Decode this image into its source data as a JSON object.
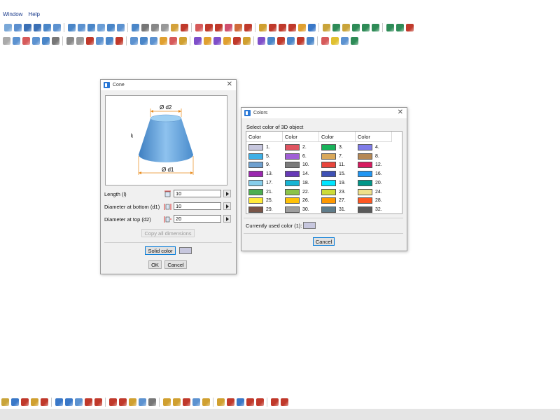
{
  "menu": [
    "Window",
    "Help"
  ],
  "cone_dialog": {
    "title": "Cone",
    "diagram": {
      "d2": "Ø d2",
      "d1": "Ø d1",
      "l": "l"
    },
    "fields": [
      {
        "label": "Length (l)",
        "value": "10"
      },
      {
        "label": "Diameter at bottom (d1)",
        "value": "10"
      },
      {
        "label": "Diameter at top (d2)",
        "value": "20"
      }
    ],
    "copy_button": "Copy all dimensions",
    "solid_color_button": "Solid color",
    "solid_color_value": "#c7c7de",
    "ok_button": "OK",
    "cancel_button": "Cancel"
  },
  "colors_dialog": {
    "title": "Colors",
    "prompt": "Select color of 3D object",
    "column_header": "Color",
    "swatches": [
      {
        "n": "1.",
        "c": "#c7c7de"
      },
      {
        "n": "2.",
        "c": "#e05561"
      },
      {
        "n": "3.",
        "c": "#19b35b"
      },
      {
        "n": "4.",
        "c": "#7f7ce8"
      },
      {
        "n": "5.",
        "c": "#3fb0e6"
      },
      {
        "n": "6.",
        "c": "#a05fd6"
      },
      {
        "n": "7.",
        "c": "#d9a85a"
      },
      {
        "n": "8.",
        "c": "#b58855"
      },
      {
        "n": "9.",
        "c": "#6ea0cf"
      },
      {
        "n": "10.",
        "c": "#7b7b7b"
      },
      {
        "n": "11.",
        "c": "#e8453c"
      },
      {
        "n": "12.",
        "c": "#d81b60"
      },
      {
        "n": "13.",
        "c": "#9c27b0"
      },
      {
        "n": "14.",
        "c": "#673ab7"
      },
      {
        "n": "15.",
        "c": "#3f51b5"
      },
      {
        "n": "16.",
        "c": "#2196f3"
      },
      {
        "n": "17.",
        "c": "#87ceeb"
      },
      {
        "n": "18.",
        "c": "#16b4d3"
      },
      {
        "n": "19.",
        "c": "#00e5ff"
      },
      {
        "n": "20.",
        "c": "#009688"
      },
      {
        "n": "21.",
        "c": "#4caf50"
      },
      {
        "n": "22.",
        "c": "#8bc34a"
      },
      {
        "n": "23.",
        "c": "#cddc39"
      },
      {
        "n": "24.",
        "c": "#efe08a"
      },
      {
        "n": "25.",
        "c": "#ffeb3b"
      },
      {
        "n": "26.",
        "c": "#ffc107"
      },
      {
        "n": "27.",
        "c": "#ff9800"
      },
      {
        "n": "28.",
        "c": "#ff5722"
      },
      {
        "n": "29.",
        "c": "#795548"
      },
      {
        "n": "30.",
        "c": "#9e9e9e"
      },
      {
        "n": "31.",
        "c": "#607d8b"
      },
      {
        "n": "32.",
        "c": "#5a5a5a"
      }
    ],
    "current_label": "Currently used color (1):",
    "current_color": "#c7c7de",
    "cancel_button": "Cancel"
  },
  "toolbar_icon_colors": {
    "row1": [
      "#7aa8d8",
      "#5b8fcf",
      "#3a6fb5",
      "#3a6fb5",
      "#4a86c8",
      "#5c92d0",
      "#4a86c8",
      "#5c92d0",
      "#4a86c8",
      "#6b9ed6",
      "#4a86c8",
      "#5c92d0",
      "#4a86c8",
      "#777777",
      "#888888",
      "#999999",
      "#d4a23a",
      "#c0392b",
      "#d65a5a",
      "#c0392b",
      "#c0392b",
      "#d0506f",
      "#d06a3a",
      "#c0392b",
      "#d0a030",
      "#c0392b",
      "#c0392b",
      "#c0392b",
      "#e0a030",
      "#3a78c8",
      "#c9a43a",
      "#2e8b57",
      "#c9a43a",
      "#2e8b57",
      "#2e8b57",
      "#2e8b57",
      "#2e8b57",
      "#2e8b57",
      "#c0392b"
    ],
    "row2": [
      "#aaaaaa",
      "#5c92d0",
      "#d65a5a",
      "#5c92d0",
      "#4a86c8",
      "#777777",
      "#888888",
      "#999999",
      "#c0392b",
      "#5c92d0",
      "#4a86c8",
      "#c0392b",
      "#5c92d0",
      "#4a86c8",
      "#5c92d0",
      "#e0a030",
      "#d65a5a",
      "#d0a030",
      "#7f4fc9",
      "#e0a030",
      "#7f4fc9",
      "#e0a030",
      "#c0392b",
      "#d0a030",
      "#7f4fc9",
      "#4a86c8",
      "#c0392b",
      "#4a86c8",
      "#c0392b",
      "#4a86c8",
      "#d65a5a",
      "#e0c030",
      "#5c92d0",
      "#2e8b57"
    ],
    "bottom": [
      "#c9a43a",
      "#3a78c8",
      "#c0392b",
      "#d0a030",
      "#c0392b",
      "#3a78c8",
      "#3a78c8",
      "#5c92d0",
      "#c0392b",
      "#c0392b",
      "#c0392b",
      "#c0392b",
      "#d0a030",
      "#5c92d0",
      "#777777",
      "#d0a030",
      "#d0a030",
      "#c0392b",
      "#5c92d0",
      "#d0a030",
      "#d0a030",
      "#c0392b",
      "#3a78c8",
      "#c0392b",
      "#c0392b",
      "#c0392b",
      "#c0392b"
    ]
  }
}
